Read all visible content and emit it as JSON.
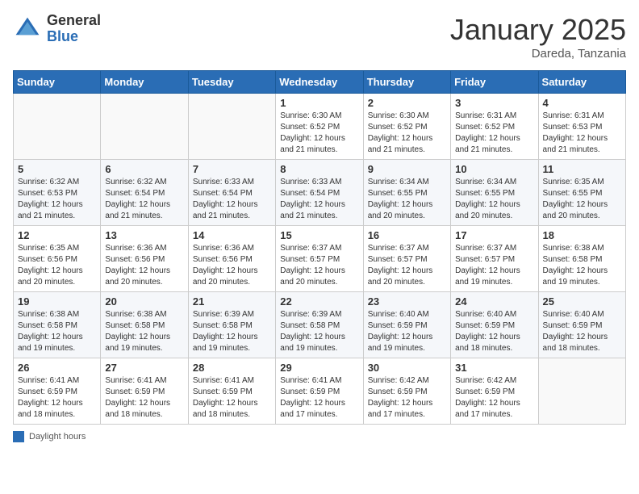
{
  "header": {
    "logo_general": "General",
    "logo_blue": "Blue",
    "month_title": "January 2025",
    "location": "Dareda, Tanzania"
  },
  "days_of_week": [
    "Sunday",
    "Monday",
    "Tuesday",
    "Wednesday",
    "Thursday",
    "Friday",
    "Saturday"
  ],
  "weeks": [
    [
      {
        "day": "",
        "sunrise": "",
        "sunset": "",
        "daylight": ""
      },
      {
        "day": "",
        "sunrise": "",
        "sunset": "",
        "daylight": ""
      },
      {
        "day": "",
        "sunrise": "",
        "sunset": "",
        "daylight": ""
      },
      {
        "day": "1",
        "sunrise": "Sunrise: 6:30 AM",
        "sunset": "Sunset: 6:52 PM",
        "daylight": "Daylight: 12 hours and 21 minutes."
      },
      {
        "day": "2",
        "sunrise": "Sunrise: 6:30 AM",
        "sunset": "Sunset: 6:52 PM",
        "daylight": "Daylight: 12 hours and 21 minutes."
      },
      {
        "day": "3",
        "sunrise": "Sunrise: 6:31 AM",
        "sunset": "Sunset: 6:52 PM",
        "daylight": "Daylight: 12 hours and 21 minutes."
      },
      {
        "day": "4",
        "sunrise": "Sunrise: 6:31 AM",
        "sunset": "Sunset: 6:53 PM",
        "daylight": "Daylight: 12 hours and 21 minutes."
      }
    ],
    [
      {
        "day": "5",
        "sunrise": "Sunrise: 6:32 AM",
        "sunset": "Sunset: 6:53 PM",
        "daylight": "Daylight: 12 hours and 21 minutes."
      },
      {
        "day": "6",
        "sunrise": "Sunrise: 6:32 AM",
        "sunset": "Sunset: 6:54 PM",
        "daylight": "Daylight: 12 hours and 21 minutes."
      },
      {
        "day": "7",
        "sunrise": "Sunrise: 6:33 AM",
        "sunset": "Sunset: 6:54 PM",
        "daylight": "Daylight: 12 hours and 21 minutes."
      },
      {
        "day": "8",
        "sunrise": "Sunrise: 6:33 AM",
        "sunset": "Sunset: 6:54 PM",
        "daylight": "Daylight: 12 hours and 21 minutes."
      },
      {
        "day": "9",
        "sunrise": "Sunrise: 6:34 AM",
        "sunset": "Sunset: 6:55 PM",
        "daylight": "Daylight: 12 hours and 20 minutes."
      },
      {
        "day": "10",
        "sunrise": "Sunrise: 6:34 AM",
        "sunset": "Sunset: 6:55 PM",
        "daylight": "Daylight: 12 hours and 20 minutes."
      },
      {
        "day": "11",
        "sunrise": "Sunrise: 6:35 AM",
        "sunset": "Sunset: 6:55 PM",
        "daylight": "Daylight: 12 hours and 20 minutes."
      }
    ],
    [
      {
        "day": "12",
        "sunrise": "Sunrise: 6:35 AM",
        "sunset": "Sunset: 6:56 PM",
        "daylight": "Daylight: 12 hours and 20 minutes."
      },
      {
        "day": "13",
        "sunrise": "Sunrise: 6:36 AM",
        "sunset": "Sunset: 6:56 PM",
        "daylight": "Daylight: 12 hours and 20 minutes."
      },
      {
        "day": "14",
        "sunrise": "Sunrise: 6:36 AM",
        "sunset": "Sunset: 6:56 PM",
        "daylight": "Daylight: 12 hours and 20 minutes."
      },
      {
        "day": "15",
        "sunrise": "Sunrise: 6:37 AM",
        "sunset": "Sunset: 6:57 PM",
        "daylight": "Daylight: 12 hours and 20 minutes."
      },
      {
        "day": "16",
        "sunrise": "Sunrise: 6:37 AM",
        "sunset": "Sunset: 6:57 PM",
        "daylight": "Daylight: 12 hours and 20 minutes."
      },
      {
        "day": "17",
        "sunrise": "Sunrise: 6:37 AM",
        "sunset": "Sunset: 6:57 PM",
        "daylight": "Daylight: 12 hours and 19 minutes."
      },
      {
        "day": "18",
        "sunrise": "Sunrise: 6:38 AM",
        "sunset": "Sunset: 6:58 PM",
        "daylight": "Daylight: 12 hours and 19 minutes."
      }
    ],
    [
      {
        "day": "19",
        "sunrise": "Sunrise: 6:38 AM",
        "sunset": "Sunset: 6:58 PM",
        "daylight": "Daylight: 12 hours and 19 minutes."
      },
      {
        "day": "20",
        "sunrise": "Sunrise: 6:38 AM",
        "sunset": "Sunset: 6:58 PM",
        "daylight": "Daylight: 12 hours and 19 minutes."
      },
      {
        "day": "21",
        "sunrise": "Sunrise: 6:39 AM",
        "sunset": "Sunset: 6:58 PM",
        "daylight": "Daylight: 12 hours and 19 minutes."
      },
      {
        "day": "22",
        "sunrise": "Sunrise: 6:39 AM",
        "sunset": "Sunset: 6:58 PM",
        "daylight": "Daylight: 12 hours and 19 minutes."
      },
      {
        "day": "23",
        "sunrise": "Sunrise: 6:40 AM",
        "sunset": "Sunset: 6:59 PM",
        "daylight": "Daylight: 12 hours and 19 minutes."
      },
      {
        "day": "24",
        "sunrise": "Sunrise: 6:40 AM",
        "sunset": "Sunset: 6:59 PM",
        "daylight": "Daylight: 12 hours and 18 minutes."
      },
      {
        "day": "25",
        "sunrise": "Sunrise: 6:40 AM",
        "sunset": "Sunset: 6:59 PM",
        "daylight": "Daylight: 12 hours and 18 minutes."
      }
    ],
    [
      {
        "day": "26",
        "sunrise": "Sunrise: 6:41 AM",
        "sunset": "Sunset: 6:59 PM",
        "daylight": "Daylight: 12 hours and 18 minutes."
      },
      {
        "day": "27",
        "sunrise": "Sunrise: 6:41 AM",
        "sunset": "Sunset: 6:59 PM",
        "daylight": "Daylight: 12 hours and 18 minutes."
      },
      {
        "day": "28",
        "sunrise": "Sunrise: 6:41 AM",
        "sunset": "Sunset: 6:59 PM",
        "daylight": "Daylight: 12 hours and 18 minutes."
      },
      {
        "day": "29",
        "sunrise": "Sunrise: 6:41 AM",
        "sunset": "Sunset: 6:59 PM",
        "daylight": "Daylight: 12 hours and 17 minutes."
      },
      {
        "day": "30",
        "sunrise": "Sunrise: 6:42 AM",
        "sunset": "Sunset: 6:59 PM",
        "daylight": "Daylight: 12 hours and 17 minutes."
      },
      {
        "day": "31",
        "sunrise": "Sunrise: 6:42 AM",
        "sunset": "Sunset: 6:59 PM",
        "daylight": "Daylight: 12 hours and 17 minutes."
      },
      {
        "day": "",
        "sunrise": "",
        "sunset": "",
        "daylight": ""
      }
    ]
  ],
  "legend": {
    "label": "Daylight hours"
  }
}
